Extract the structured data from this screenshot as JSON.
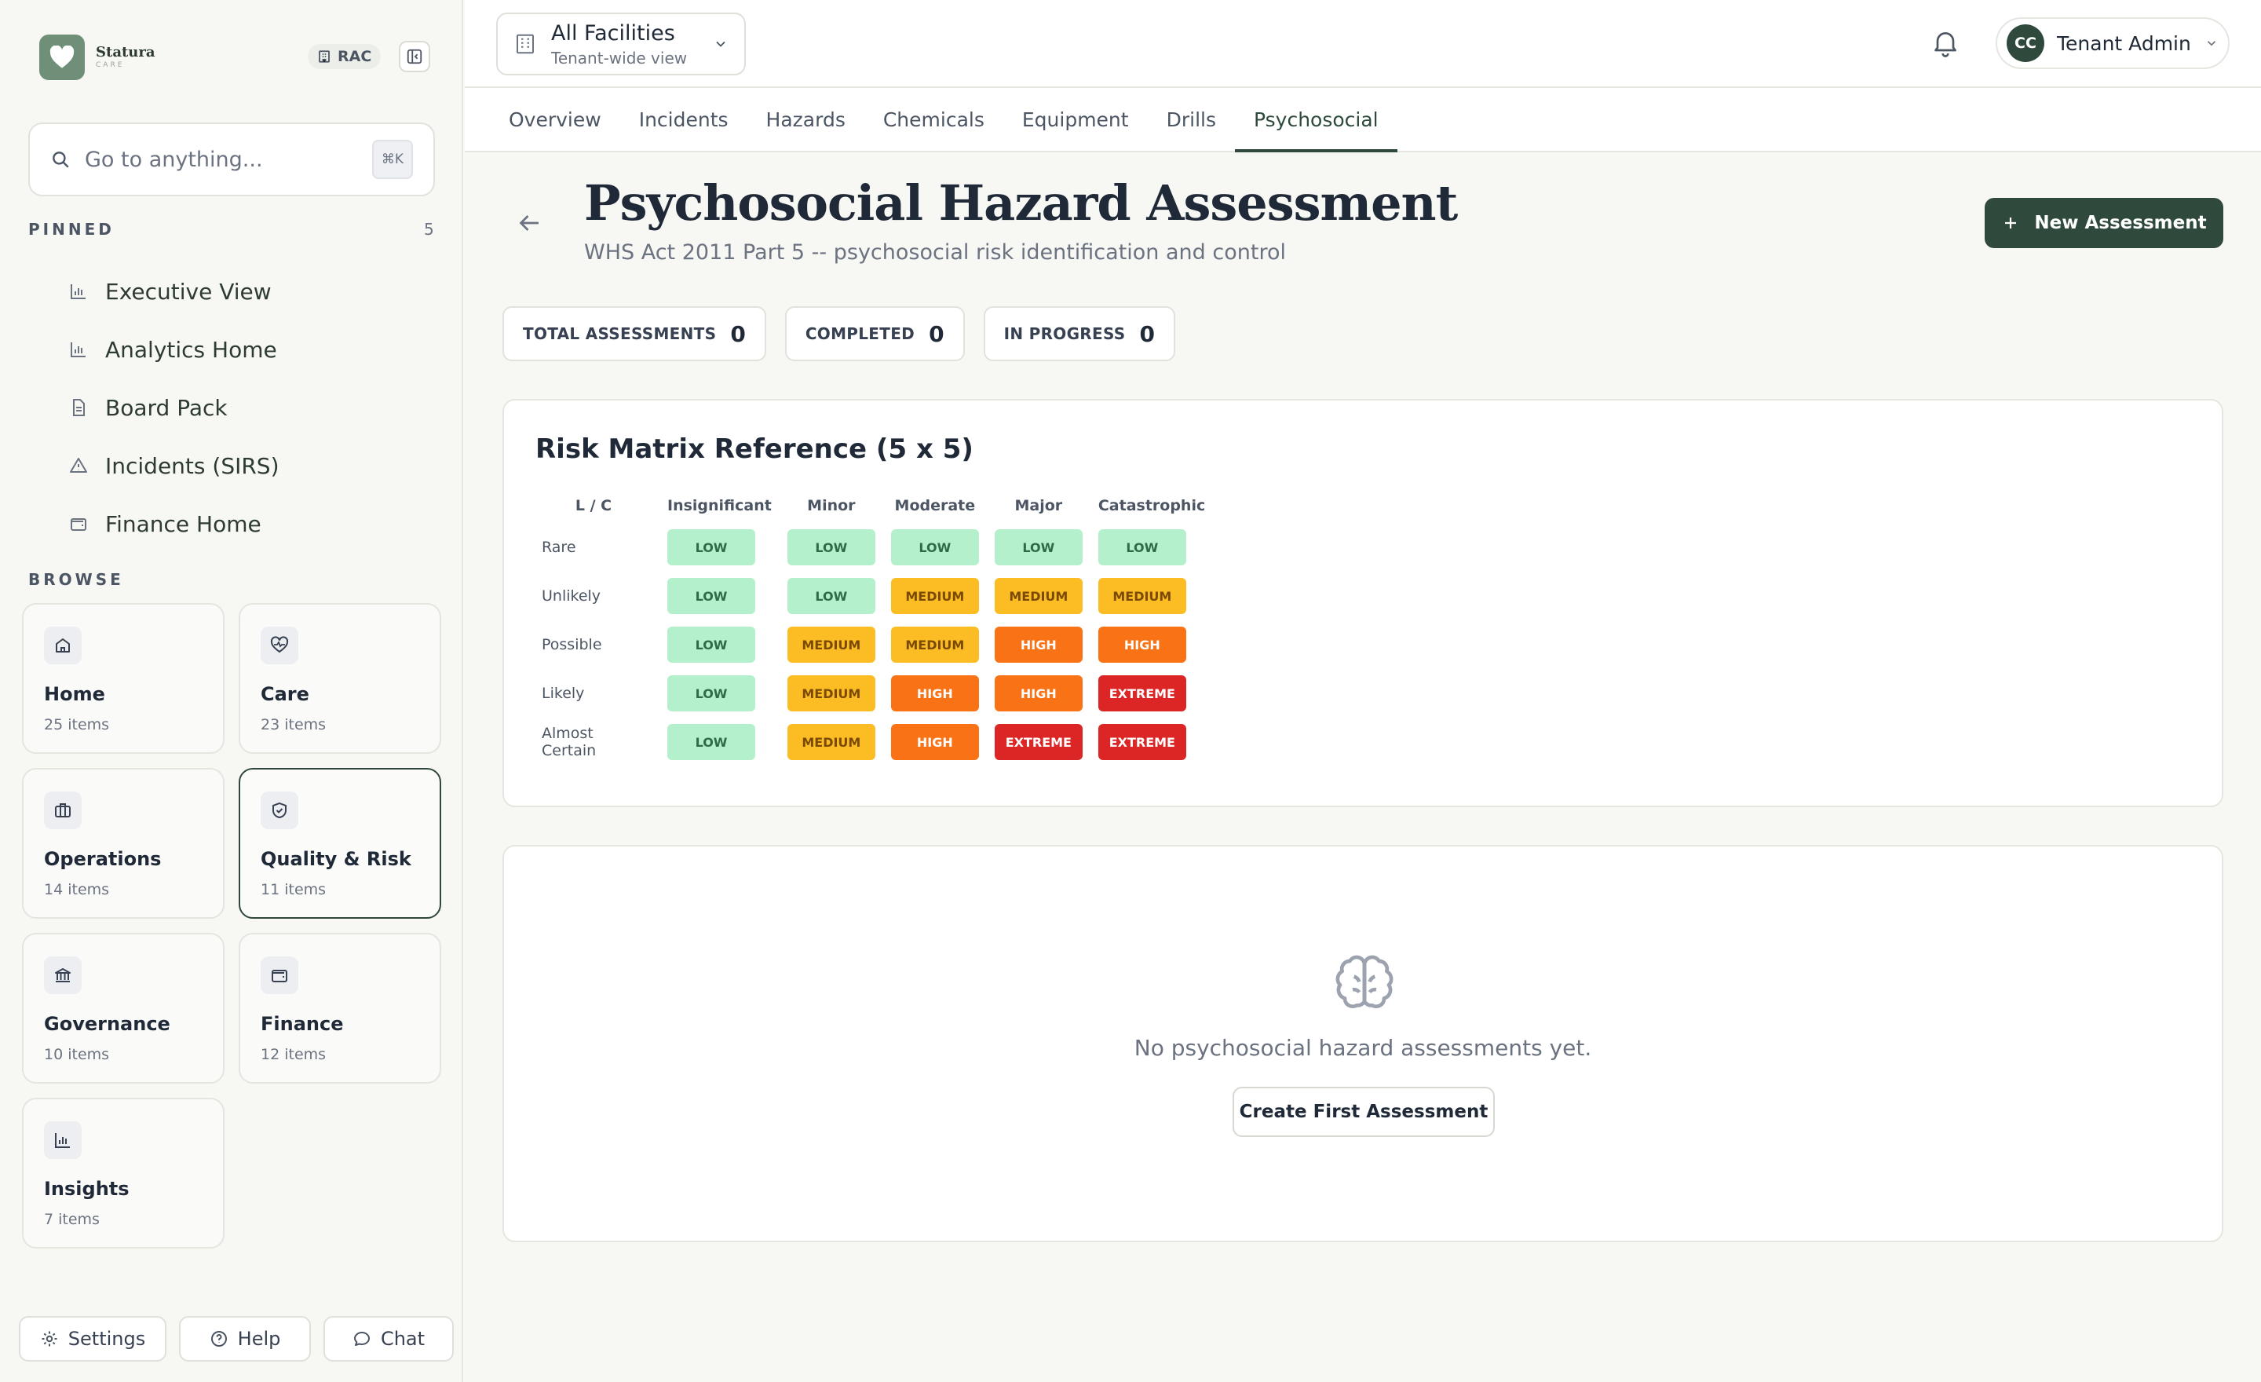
{
  "brand": {
    "name": "Statura",
    "sub": "CARE"
  },
  "tenant_badge": "RAC",
  "search": {
    "placeholder": "Go to anything...",
    "shortcut": "⌘K"
  },
  "pinned": {
    "label": "PINNED",
    "count": "5",
    "items": [
      {
        "label": "Executive View",
        "icon": "bar-chart-icon"
      },
      {
        "label": "Analytics Home",
        "icon": "bar-chart-icon"
      },
      {
        "label": "Board Pack",
        "icon": "document-icon"
      },
      {
        "label": "Incidents (SIRS)",
        "icon": "warning-triangle-icon"
      },
      {
        "label": "Finance Home",
        "icon": "wallet-icon"
      }
    ]
  },
  "browse": {
    "label": "BROWSE",
    "tiles": [
      {
        "title": "Home",
        "sub": "25 items",
        "icon": "home-icon"
      },
      {
        "title": "Care",
        "sub": "23 items",
        "icon": "heart-pulse-icon"
      },
      {
        "title": "Operations",
        "sub": "14 items",
        "icon": "briefcase-icon"
      },
      {
        "title": "Quality & Risk",
        "sub": "11 items",
        "icon": "shield-check-icon",
        "active": true
      },
      {
        "title": "Governance",
        "sub": "10 items",
        "icon": "bank-icon"
      },
      {
        "title": "Finance",
        "sub": "12 items",
        "icon": "wallet-icon"
      },
      {
        "title": "Insights",
        "sub": "7 items",
        "icon": "bar-chart-icon"
      }
    ]
  },
  "bottom": {
    "settings": "Settings",
    "help": "Help",
    "chat": "Chat"
  },
  "facility": {
    "title": "All Facilities",
    "sub": "Tenant-wide view"
  },
  "user": {
    "initials": "CC",
    "name": "Tenant Admin"
  },
  "tabs": [
    "Overview",
    "Incidents",
    "Hazards",
    "Chemicals",
    "Equipment",
    "Drills",
    "Psychosocial"
  ],
  "active_tab": "Psychosocial",
  "page": {
    "title": "Psychosocial Hazard Assessment",
    "subtitle": "WHS Act 2011 Part 5 -- psychosocial risk identification and control",
    "new_button": "New Assessment"
  },
  "stats": [
    {
      "label": "TOTAL ASSESSMENTS",
      "value": "0"
    },
    {
      "label": "COMPLETED",
      "value": "0"
    },
    {
      "label": "IN PROGRESS",
      "value": "0"
    }
  ],
  "matrix": {
    "title": "Risk Matrix Reference (5 x 5)",
    "corner": "L / C",
    "columns": [
      "Insignificant",
      "Minor",
      "Moderate",
      "Major",
      "Catastrophic"
    ],
    "rows": [
      {
        "label": "Rare",
        "cells": [
          "LOW",
          "LOW",
          "LOW",
          "LOW",
          "LOW"
        ]
      },
      {
        "label": "Unlikely",
        "cells": [
          "LOW",
          "LOW",
          "MEDIUM",
          "MEDIUM",
          "MEDIUM"
        ]
      },
      {
        "label": "Possible",
        "cells": [
          "LOW",
          "MEDIUM",
          "MEDIUM",
          "HIGH",
          "HIGH"
        ]
      },
      {
        "label": "Likely",
        "cells": [
          "LOW",
          "MEDIUM",
          "HIGH",
          "HIGH",
          "EXTREME"
        ]
      },
      {
        "label": "Almost Certain",
        "cells": [
          "LOW",
          "MEDIUM",
          "HIGH",
          "EXTREME",
          "EXTREME"
        ]
      }
    ],
    "colors": {
      "LOW": "#b5f0cc",
      "MEDIUM": "#fbbd23",
      "HIGH": "#f97316",
      "EXTREME": "#dc2626"
    }
  },
  "empty": {
    "icon": "brain-icon",
    "text": "No psychosocial hazard assessments yet.",
    "button": "Create First Assessment"
  },
  "colors": {
    "accent": "#2f4a3c",
    "background": "#f7f7f4"
  }
}
